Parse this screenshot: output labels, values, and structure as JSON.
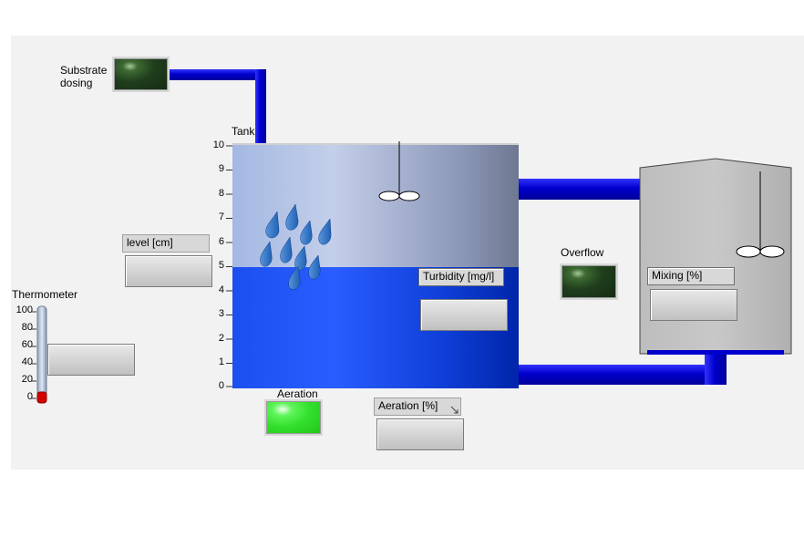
{
  "labels": {
    "substrate_dosing": "Substrate\ndosing",
    "tank": "Tank",
    "thermometer": "Thermometer",
    "overflow": "Overflow",
    "aeration": "Aeration"
  },
  "indicators": {
    "level_caption": "level [cm]",
    "turbidity_caption": "Turbidity [mg/l]",
    "mixing_caption": "Mixing [%]",
    "aeration_caption": "Aeration [%]"
  },
  "tank_scale": [
    "10",
    "9",
    "8",
    "7",
    "6",
    "5",
    "4",
    "3",
    "2",
    "1",
    "0"
  ],
  "thermo_scale": [
    "100",
    "80",
    "60",
    "40",
    "20",
    "0"
  ],
  "tank": {
    "level": 5,
    "max": 10
  },
  "thermometer": {
    "value": 0,
    "max": 100
  },
  "leds": {
    "substrate_dosing": "off",
    "overflow": "off",
    "aeration": "on"
  },
  "colors": {
    "pipe": "#0000cc",
    "water": "#1155ee",
    "led_on": "#33e02d",
    "led_off": "#1f3e1c",
    "thermo_fluid": "#dd0000"
  },
  "icons": [
    "water-drop-icon",
    "agitator-icon"
  ]
}
